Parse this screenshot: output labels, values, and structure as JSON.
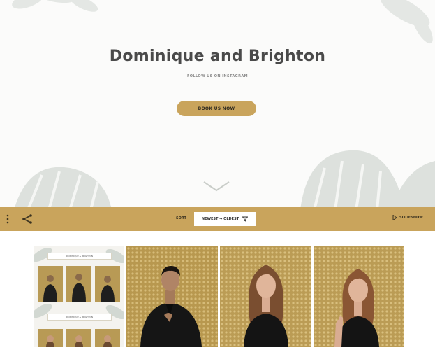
{
  "hero": {
    "title": "Dominique and Brighton",
    "subtitle": "FOLLOW US ON INSTAGRAM",
    "book_button": "BOOK US NOW"
  },
  "toolbar": {
    "sort_label": "SORT",
    "sort_value": "NEWEST → OLDEST",
    "slideshow_label": "SLIDESHOW"
  },
  "gallery": {
    "strip_banner": "DOMINIQUE & BRIGHTON"
  },
  "colors": {
    "accent": "#c9a45c",
    "title_text": "#4a4a4a"
  }
}
